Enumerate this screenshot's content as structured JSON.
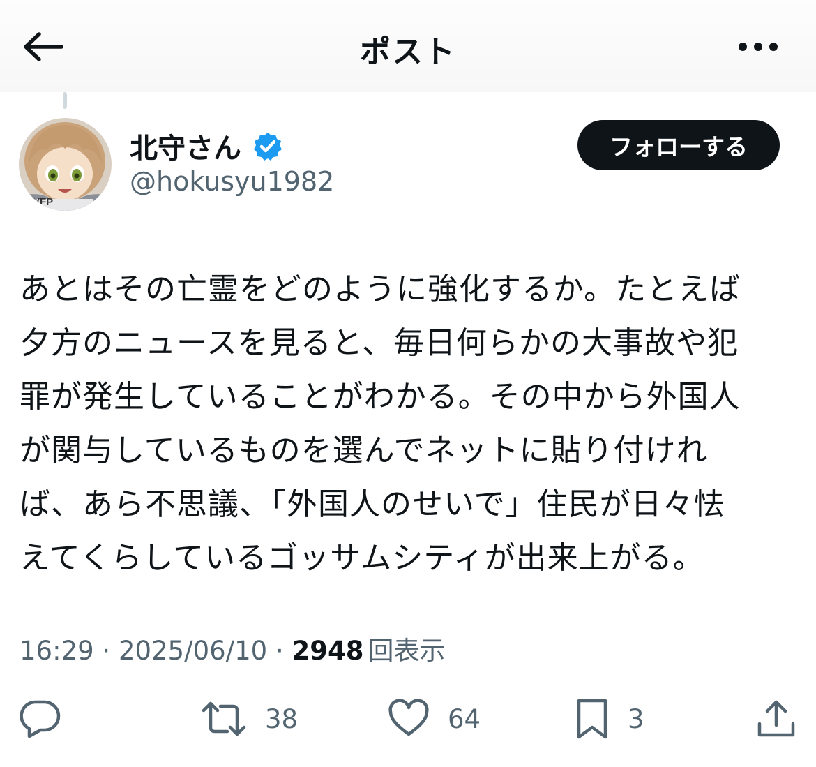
{
  "header": {
    "title": "ポスト",
    "back_icon": "arrow-left-icon",
    "more_icon": "more-horizontal-icon"
  },
  "author": {
    "name": "北守さん",
    "handle": "@hokusyu1982",
    "verified": true,
    "verified_color": "#1d9bf0",
    "avatar_text": "VFP"
  },
  "follow_button": {
    "label": "フォローする"
  },
  "post": {
    "lines": [
      "あとはその亡霊をどのように強化するか。たとえば",
      "夕方のニュースを見ると、毎日何らかの大事故や犯",
      "罪が発生していることがわかる。その中から外国人",
      "が関与しているものを選んでネットに貼り付けれ",
      "ば、あら不思議、「外国人のせいで」住民が日々怯",
      "えてくらしているゴッサムシティが出来上がる。"
    ]
  },
  "meta": {
    "time": "16:29",
    "sep1": " · ",
    "date": "2025/06/10",
    "sep2": " · ",
    "views": "2948",
    "views_label": "回表示"
  },
  "actions": {
    "reply": {
      "icon": "reply-icon",
      "count": ""
    },
    "repost": {
      "icon": "repost-icon",
      "count": "38"
    },
    "like": {
      "icon": "heart-icon",
      "count": "64"
    },
    "bookmark": {
      "icon": "bookmark-icon",
      "count": "3"
    },
    "share": {
      "icon": "share-icon",
      "count": ""
    }
  },
  "colors": {
    "text": "#0f1419",
    "secondary": "#536471",
    "follow_bg": "#0f1419",
    "verified": "#1d9bf0"
  }
}
